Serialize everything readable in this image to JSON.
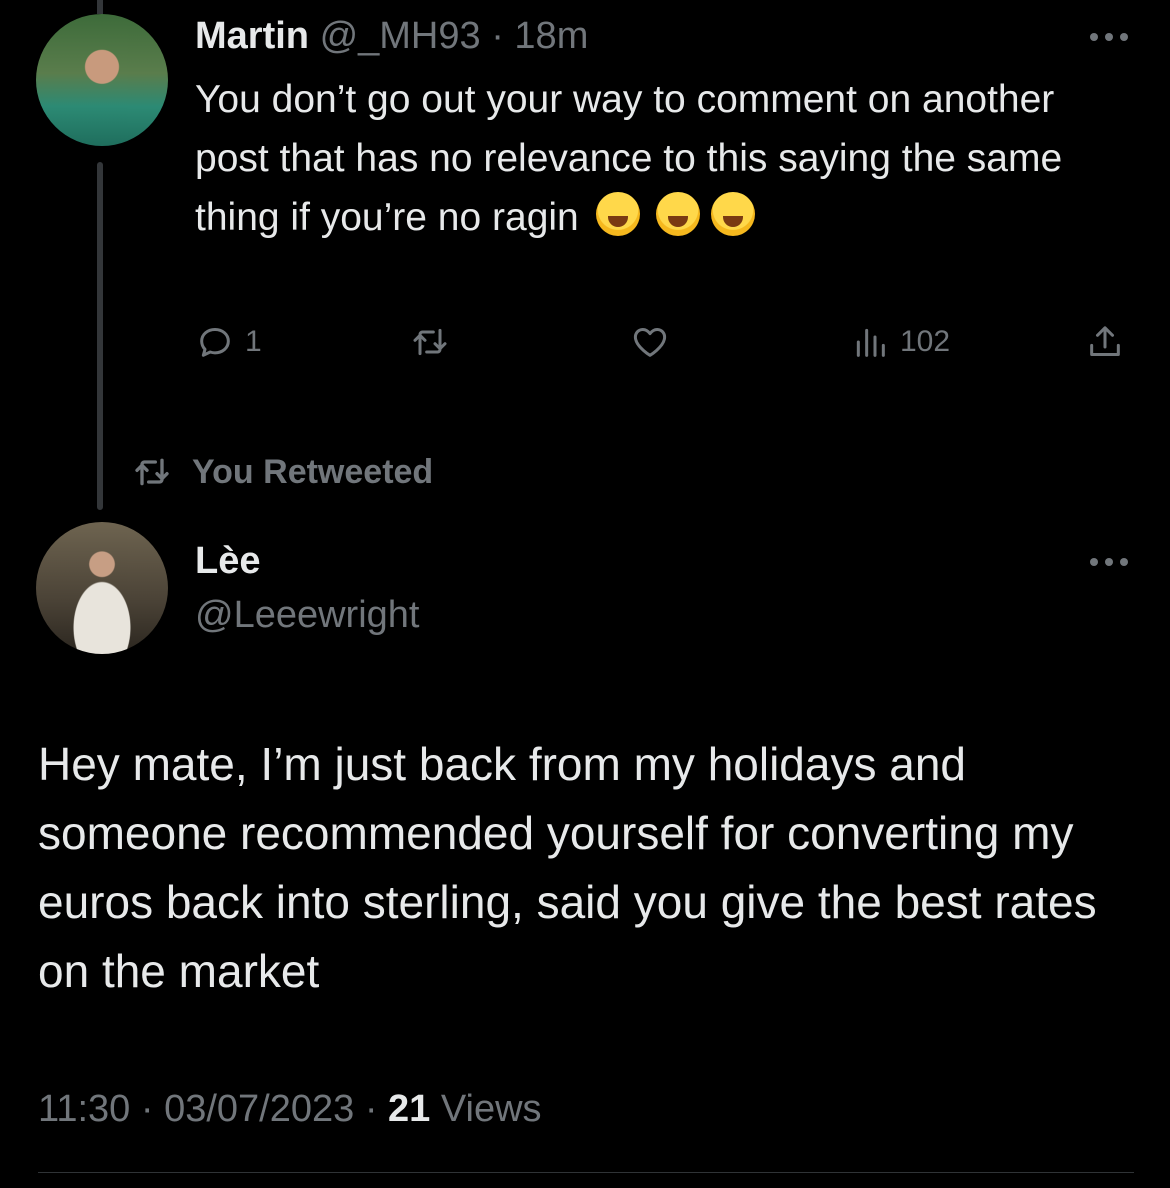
{
  "reply_tweet": {
    "author_name": "Martin",
    "author_handle": "@_MH93",
    "separator": "·",
    "time_ago": "18m",
    "text": "You don’t go out your way to comment on another post that has no relevance to this saying the same thing if you’re no ragin",
    "emoji_count": 3,
    "emoji_name": "face-with-tears-of-joy",
    "reply_count": "1",
    "retweet_count": "",
    "like_count": "",
    "view_count": "102"
  },
  "retweet_banner": {
    "label": "You Retweeted"
  },
  "main_tweet": {
    "author_name": "Lèe",
    "author_handle": "@Leeewright",
    "text": "Hey mate, I’m just back from my holidays and someone recommended yourself for converting my euros back into sterling, said you give the best rates on the market",
    "time": "11:30",
    "date": "03/07/2023",
    "views_count": "21",
    "views_label": "Views",
    "meta_separator": "·"
  },
  "colors": {
    "background": "#000000",
    "text_primary": "#e7e9ea",
    "text_secondary": "#71767b",
    "divider": "#2f3336"
  }
}
